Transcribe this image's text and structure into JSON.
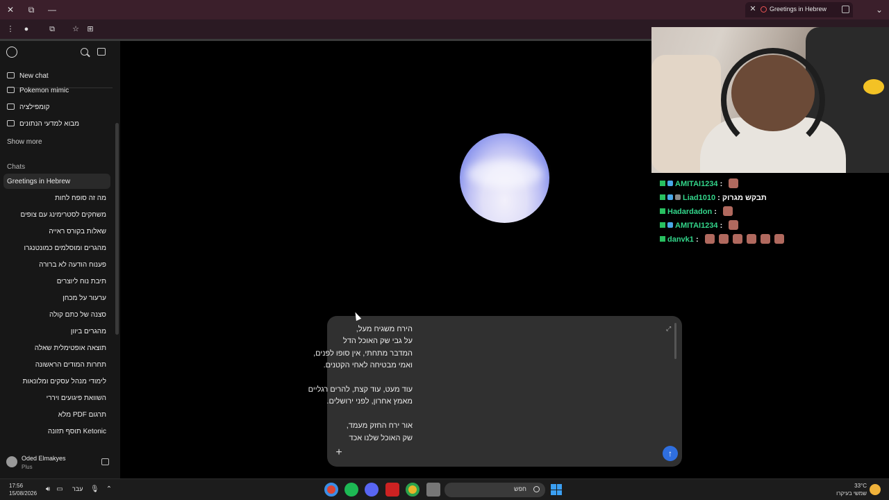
{
  "browser": {
    "tab_title": "Greetings in Hebrew",
    "tab_close": "✕",
    "new_tab": "+",
    "window_close": "✕",
    "window_restore": "⧉",
    "window_min": "—"
  },
  "sidebar": {
    "new_chat": "New chat",
    "projects": [
      "Pokemon mimic",
      "קומפילציה",
      "מבוא למדעי הנתונים"
    ],
    "show_more": "Show more",
    "chats_label": "Chats",
    "active_chat": "Greetings in Hebrew",
    "chats": [
      "מה זה סופח לחות",
      "משחקים לסטרימינג עם צופים",
      "שאלות בקורס ראייה",
      "מהגרים ומוסלמים כמונטנגרו",
      "פענוח הודעה לא ברורה",
      "תיבת נוח ליוצרים",
      "ערעור על מכחן",
      "סצנה של כתם קולה",
      "מהגרים ביוון",
      "תוצאה אופטימלית שאלה",
      "תחרות המודים הראשונה",
      "לימודי מנהל עסקים ומלונאות",
      "השוואת פיגועים ויררי",
      "תרגום PDF מלא",
      "Ketonic תוסף תזונה"
    ],
    "user_name": "Oded Elmakyes",
    "user_plan": "Plus"
  },
  "composer": {
    "lines": [
      "הירח משגיח מעל,",
      "על גבי שק האוכל הדל",
      "המדבר מתחתי, אין סופו לפנים,",
      "ואמי מבטיחה לאחי הקטנים.",
      "",
      "עוד מעט, עוד קצת, להרים רגליים",
      "מאמץ אחרון, לפני ירושלים.",
      "",
      "אור ירח החזק מעמד,",
      "שק האוכל שלנו אכד"
    ],
    "plus": "+",
    "send": "↑",
    "expand": "⤢"
  },
  "stream_chat": [
    {
      "user": "AMITAI1234",
      "text": "",
      "emotes": 1
    },
    {
      "user": "Liad1010",
      "text": "תבקש מגרוק",
      "emotes": 0
    },
    {
      "user": "Hadardadon",
      "text": "",
      "emotes": 1
    },
    {
      "user": "AMITAI1234",
      "text": "",
      "emotes": 1
    },
    {
      "user": "danvk1",
      "text": "",
      "emotes": 6
    }
  ],
  "taskbar": {
    "time": "17:56",
    "date": "15/08/2026",
    "lang": "עבר",
    "search_label": "חפש",
    "temp": "33°C",
    "weather": "שמשי בעיקרו",
    "notif_count": "3"
  },
  "colors": {
    "accent": "#2f6fdf",
    "chat_user": "#33d68b",
    "tab_bar": "#3b1f2b"
  }
}
